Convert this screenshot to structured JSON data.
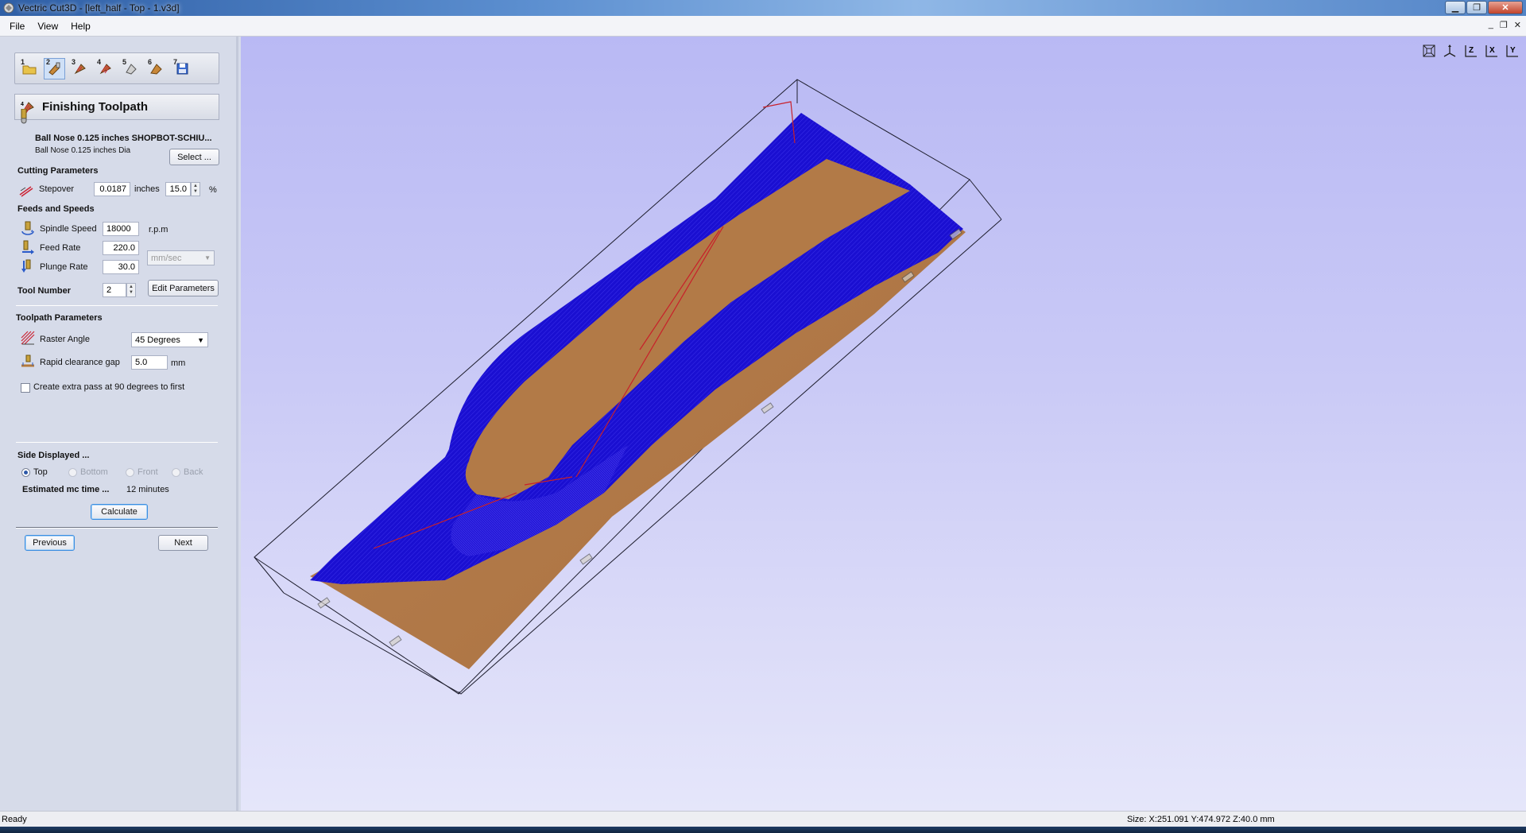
{
  "window": {
    "title": "Vectric Cut3D - [left_half - Top - 1.v3d]"
  },
  "menu": {
    "items": [
      "File",
      "View",
      "Help"
    ]
  },
  "steps": {
    "numbers": [
      "1",
      "2",
      "3",
      "4",
      "5",
      "6",
      "7"
    ],
    "active_index": 1
  },
  "panel": {
    "title": "Finishing Toolpath",
    "tool": {
      "name": "Ball Nose 0.125 inches SHOPBOT-SCHIU...",
      "description": "Ball Nose 0.125 inches Dia",
      "select_label": "Select ..."
    },
    "cutting": {
      "heading": "Cutting Parameters",
      "stepover_label": "Stepover",
      "stepover_value": "0.0187",
      "stepover_unit": "inches",
      "stepover_percent": "15.0",
      "percent_sign": "%"
    },
    "feeds": {
      "heading": "Feeds and Speeds",
      "spindle_label": "Spindle Speed",
      "spindle_value": "18000",
      "spindle_unit": "r.p.m",
      "feed_label": "Feed Rate",
      "feed_value": "220.0",
      "plunge_label": "Plunge Rate",
      "plunge_value": "30.0",
      "rate_unit": "mm/sec",
      "tool_number_label": "Tool Number",
      "tool_number_value": "2",
      "edit_params_label": "Edit Parameters"
    },
    "toolpath": {
      "heading": "Toolpath Parameters",
      "raster_label": "Raster Angle",
      "raster_value": "45 Degrees",
      "clearance_label": "Rapid clearance gap",
      "clearance_value": "5.0",
      "clearance_unit": "mm",
      "extra_pass_label": "Create extra pass at 90 degrees to first"
    },
    "side": {
      "heading": "Side Displayed ...",
      "options": [
        "Top",
        "Bottom",
        "Front",
        "Back"
      ],
      "selected": "Top",
      "time_label": "Estimated mc time ...",
      "time_value": "12 minutes",
      "calculate_label": "Calculate"
    },
    "nav": {
      "previous_label": "Previous",
      "next_label": "Next"
    }
  },
  "colors": {
    "toolpath_blue": "#1a0fd1",
    "material_tan": "#b27a47",
    "viewport_top": "#b9b9f4",
    "viewport_bottom": "#e5e6fa"
  },
  "view_tools": [
    "fit-view-icon",
    "iso-view-icon",
    "top-z-view-icon",
    "front-x-view-icon",
    "side-y-view-icon"
  ],
  "status": {
    "left": "Ready",
    "right": "Size: X:251.091 Y:474.972 Z:40.0 mm"
  }
}
